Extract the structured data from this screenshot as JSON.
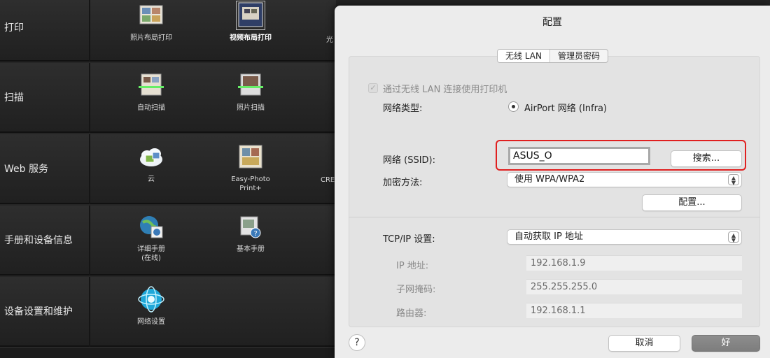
{
  "background_app": {
    "categories": [
      {
        "label": "打印"
      },
      {
        "label": "扫描"
      },
      {
        "label": "Web 服务"
      },
      {
        "label": "手册和设备信息"
      },
      {
        "label": "设备设置和维护"
      }
    ],
    "items": {
      "photo_layout_print": "照片布局打印",
      "video_layout_print": "视频布局打印",
      "print_partial": "光",
      "auto_scan": "自动扫描",
      "photo_scan": "照片扫描",
      "cloud": "云",
      "easy_photo_print_line1": "Easy-Photo",
      "easy_photo_print_line2": "Print+",
      "web_partial": "CRE",
      "detailed_manual_line1": "详细手册",
      "detailed_manual_line2": "(在线)",
      "basic_manual": "基本手册",
      "network_settings": "网络设置"
    }
  },
  "dialog": {
    "title": "配置",
    "tabs": [
      {
        "label": "无线 LAN",
        "active": true
      },
      {
        "label": "管理员密码",
        "active": false
      }
    ],
    "use_wireless_lan_checkbox": {
      "label": "通过无线 LAN 连接使用打印机",
      "checked": true,
      "enabled": false
    },
    "network_type": {
      "label": "网络类型:",
      "value": "AirPort 网络 (Infra)"
    },
    "ssid": {
      "label": "网络 (SSID):",
      "value": "ASUS_O",
      "search_button": "搜索..."
    },
    "encryption": {
      "label": "加密方法:",
      "value": "使用 WPA/WPA2",
      "configure_button": "配置..."
    },
    "tcpip": {
      "label": "TCP/IP 设置:",
      "value": "自动获取 IP 地址"
    },
    "ip_address": {
      "label": "IP 地址:",
      "value": "192.168.1.9"
    },
    "subnet_mask": {
      "label": "子网掩码:",
      "value": "255.255.255.0"
    },
    "router": {
      "label": "路由器:",
      "value": "192.168.1.1"
    },
    "help_label": "?",
    "cancel_button": "取消",
    "ok_button": "好",
    "highlight_color": "#e02020"
  }
}
